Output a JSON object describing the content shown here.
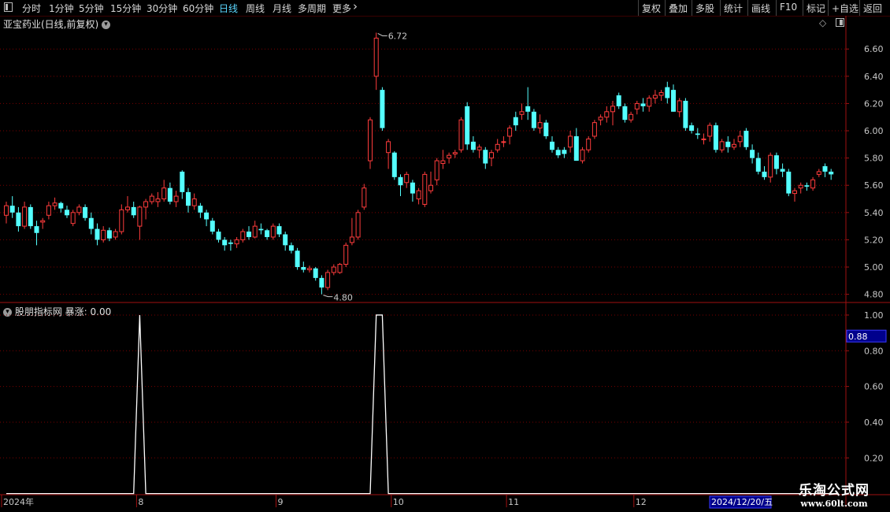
{
  "toolbar": {
    "left": [
      "分时",
      "1分钟",
      "5分钟",
      "15分钟",
      "30分钟",
      "60分钟",
      "日线",
      "周线",
      "月线",
      "多周期",
      "更多"
    ],
    "active": "日线",
    "right": [
      "复权",
      "叠加",
      "多股",
      "统计",
      "画线",
      "F10",
      "标记",
      "+自选",
      "返回"
    ]
  },
  "main_panel": {
    "title": "亚宝药业(日线,前复权)"
  },
  "indicator_panel": {
    "title": "股朋指标网",
    "series_label": "暴涨: 0.00",
    "cursor_value": "0.88"
  },
  "chart_data": [
    {
      "type": "candlestick",
      "title": "亚宝药业(日线,前复权)",
      "y_ticks": [
        "6.60",
        "6.40",
        "6.20",
        "6.00",
        "5.80",
        "5.60",
        "5.40",
        "5.20",
        "5.00",
        "4.80"
      ],
      "ylim": [
        4.74,
        6.74
      ],
      "high_label": "6.72",
      "low_label": "4.80",
      "colors": {
        "up": "#ff3c3c",
        "down": "#54ffff",
        "grid": "#7a0000",
        "axis": "#a01010"
      },
      "ohlc": [
        [
          5.38,
          5.48,
          5.32,
          5.45
        ],
        [
          5.45,
          5.52,
          5.36,
          5.4
        ],
        [
          5.4,
          5.44,
          5.26,
          5.3
        ],
        [
          5.3,
          5.48,
          5.28,
          5.44
        ],
        [
          5.44,
          5.46,
          5.28,
          5.3
        ],
        [
          5.3,
          5.34,
          5.16,
          5.25
        ],
        [
          5.33,
          5.36,
          5.28,
          5.34
        ],
        [
          5.38,
          5.48,
          5.35,
          5.45
        ],
        [
          5.45,
          5.51,
          5.42,
          5.47
        ],
        [
          5.47,
          5.48,
          5.4,
          5.43
        ],
        [
          5.42,
          5.45,
          5.36,
          5.38
        ],
        [
          5.32,
          5.42,
          5.3,
          5.4
        ],
        [
          5.4,
          5.46,
          5.38,
          5.44
        ],
        [
          5.44,
          5.46,
          5.34,
          5.36
        ],
        [
          5.36,
          5.4,
          5.24,
          5.28
        ],
        [
          5.28,
          5.32,
          5.16,
          5.2
        ],
        [
          5.2,
          5.3,
          5.18,
          5.27
        ],
        [
          5.27,
          5.29,
          5.19,
          5.21
        ],
        [
          5.22,
          5.28,
          5.2,
          5.26
        ],
        [
          5.26,
          5.46,
          5.24,
          5.42
        ],
        [
          5.42,
          5.52,
          5.4,
          5.44
        ],
        [
          5.44,
          5.48,
          5.36,
          5.38
        ],
        [
          5.3,
          5.45,
          5.2,
          5.44
        ],
        [
          5.44,
          5.5,
          5.35,
          5.48
        ],
        [
          5.48,
          5.54,
          5.46,
          5.52
        ],
        [
          5.48,
          5.55,
          5.44,
          5.5
        ],
        [
          5.5,
          5.64,
          5.48,
          5.58
        ],
        [
          5.58,
          5.62,
          5.46,
          5.48
        ],
        [
          5.48,
          5.56,
          5.44,
          5.52
        ],
        [
          5.7,
          5.71,
          5.5,
          5.55
        ],
        [
          5.55,
          5.58,
          5.4,
          5.45
        ],
        [
          5.45,
          5.54,
          5.42,
          5.5
        ],
        [
          5.45,
          5.47,
          5.36,
          5.4
        ],
        [
          5.4,
          5.42,
          5.3,
          5.35
        ],
        [
          5.34,
          5.36,
          5.24,
          5.26
        ],
        [
          5.26,
          5.28,
          5.18,
          5.2
        ],
        [
          5.2,
          5.22,
          5.12,
          5.16
        ],
        [
          5.18,
          5.2,
          5.12,
          5.17
        ],
        [
          5.17,
          5.22,
          5.14,
          5.2
        ],
        [
          5.2,
          5.28,
          5.18,
          5.26
        ],
        [
          5.26,
          5.3,
          5.2,
          5.22
        ],
        [
          5.22,
          5.34,
          5.21,
          5.3
        ],
        [
          5.28,
          5.32,
          5.24,
          5.27
        ],
        [
          5.27,
          5.28,
          5.2,
          5.22
        ],
        [
          5.22,
          5.32,
          5.2,
          5.3
        ],
        [
          5.3,
          5.32,
          5.22,
          5.24
        ],
        [
          5.24,
          5.26,
          5.12,
          5.16
        ],
        [
          5.16,
          5.18,
          5.1,
          5.12
        ],
        [
          5.12,
          5.14,
          4.98,
          5.0
        ],
        [
          5.0,
          5.04,
          4.96,
          4.98
        ],
        [
          4.98,
          5.01,
          4.96,
          4.99
        ],
        [
          4.99,
          5.0,
          4.9,
          4.92
        ],
        [
          4.92,
          4.94,
          4.8,
          4.85
        ],
        [
          4.85,
          4.98,
          4.83,
          4.96
        ],
        [
          4.96,
          5.02,
          4.94,
          5.0
        ],
        [
          4.96,
          5.03,
          4.95,
          5.02
        ],
        [
          5.02,
          5.18,
          5.0,
          5.16
        ],
        [
          5.18,
          5.36,
          5.16,
          5.22
        ],
        [
          5.22,
          5.42,
          5.2,
          5.4
        ],
        [
          5.44,
          5.61,
          5.42,
          5.58
        ],
        [
          5.78,
          6.1,
          5.72,
          6.08
        ],
        [
          6.4,
          6.72,
          6.3,
          6.68
        ],
        [
          6.3,
          6.32,
          6.0,
          6.02
        ],
        [
          5.84,
          5.94,
          5.72,
          5.92
        ],
        [
          5.84,
          5.85,
          5.64,
          5.66
        ],
        [
          5.66,
          5.68,
          5.52,
          5.6
        ],
        [
          5.62,
          5.7,
          5.58,
          5.68
        ],
        [
          5.62,
          5.64,
          5.48,
          5.54
        ],
        [
          5.5,
          5.58,
          5.46,
          5.56
        ],
        [
          5.46,
          5.7,
          5.44,
          5.68
        ],
        [
          5.56,
          5.7,
          5.54,
          5.6
        ],
        [
          5.64,
          5.8,
          5.6,
          5.78
        ],
        [
          5.76,
          5.86,
          5.72,
          5.78
        ],
        [
          5.8,
          5.84,
          5.76,
          5.82
        ],
        [
          5.83,
          5.86,
          5.8,
          5.84
        ],
        [
          5.86,
          6.1,
          5.84,
          6.08
        ],
        [
          6.18,
          6.21,
          5.86,
          5.9
        ],
        [
          5.92,
          5.96,
          5.84,
          5.86
        ],
        [
          5.86,
          5.9,
          5.8,
          5.88
        ],
        [
          5.86,
          5.88,
          5.72,
          5.76
        ],
        [
          5.8,
          5.86,
          5.74,
          5.84
        ],
        [
          5.86,
          5.94,
          5.84,
          5.9
        ],
        [
          5.92,
          5.96,
          5.88,
          5.92
        ],
        [
          5.96,
          6.04,
          5.9,
          6.02
        ],
        [
          6.1,
          6.14,
          6.0,
          6.04
        ],
        [
          6.12,
          6.2,
          6.08,
          6.14
        ],
        [
          6.18,
          6.32,
          6.08,
          6.14
        ],
        [
          6.14,
          6.16,
          6.0,
          6.02
        ],
        [
          6.02,
          6.12,
          5.98,
          6.06
        ],
        [
          6.06,
          6.08,
          5.94,
          5.96
        ],
        [
          5.92,
          5.96,
          5.84,
          5.86
        ],
        [
          5.86,
          5.88,
          5.8,
          5.82
        ],
        [
          5.86,
          5.88,
          5.8,
          5.83
        ],
        [
          5.88,
          6.0,
          5.84,
          5.96
        ],
        [
          5.96,
          6.02,
          5.78,
          5.78
        ],
        [
          5.78,
          5.88,
          5.76,
          5.86
        ],
        [
          5.86,
          5.96,
          5.84,
          5.94
        ],
        [
          5.96,
          6.08,
          5.94,
          6.06
        ],
        [
          6.08,
          6.12,
          6.04,
          6.1
        ],
        [
          6.1,
          6.18,
          6.06,
          6.14
        ],
        [
          6.14,
          6.22,
          6.04,
          6.18
        ],
        [
          6.26,
          6.28,
          6.16,
          6.18
        ],
        [
          6.18,
          6.2,
          6.06,
          6.08
        ],
        [
          6.08,
          6.14,
          6.06,
          6.12
        ],
        [
          6.16,
          6.22,
          6.12,
          6.2
        ],
        [
          6.2,
          6.24,
          6.14,
          6.18
        ],
        [
          6.18,
          6.26,
          6.14,
          6.24
        ],
        [
          6.24,
          6.3,
          6.2,
          6.26
        ],
        [
          6.26,
          6.3,
          6.22,
          6.28
        ],
        [
          6.32,
          6.36,
          6.2,
          6.24
        ],
        [
          6.3,
          6.34,
          6.14,
          6.14
        ],
        [
          6.14,
          6.24,
          6.1,
          6.22
        ],
        [
          6.22,
          6.24,
          6.0,
          6.02
        ],
        [
          6.04,
          6.06,
          5.98,
          6.0
        ],
        [
          5.98,
          6.02,
          5.94,
          5.97
        ],
        [
          5.94,
          5.98,
          5.9,
          5.94
        ],
        [
          5.96,
          6.06,
          5.92,
          6.04
        ],
        [
          6.04,
          6.06,
          5.84,
          5.86
        ],
        [
          5.86,
          5.94,
          5.84,
          5.92
        ],
        [
          5.92,
          5.96,
          5.84,
          5.88
        ],
        [
          5.88,
          5.94,
          5.86,
          5.9
        ],
        [
          5.92,
          6.0,
          5.88,
          5.96
        ],
        [
          6.0,
          6.02,
          5.86,
          5.88
        ],
        [
          5.86,
          5.9,
          5.76,
          5.8
        ],
        [
          5.8,
          5.84,
          5.68,
          5.7
        ],
        [
          5.7,
          5.74,
          5.64,
          5.66
        ],
        [
          5.66,
          5.84,
          5.62,
          5.82
        ],
        [
          5.82,
          5.84,
          5.68,
          5.72
        ],
        [
          5.72,
          5.76,
          5.66,
          5.7
        ],
        [
          5.7,
          5.72,
          5.52,
          5.54
        ],
        [
          5.54,
          5.58,
          5.48,
          5.56
        ],
        [
          5.58,
          5.62,
          5.54,
          5.6
        ],
        [
          5.6,
          5.62,
          5.56,
          5.59
        ],
        [
          5.58,
          5.66,
          5.56,
          5.64
        ],
        [
          5.68,
          5.72,
          5.66,
          5.7
        ],
        [
          5.74,
          5.76,
          5.66,
          5.7
        ],
        [
          5.7,
          5.72,
          5.64,
          5.68
        ]
      ]
    },
    {
      "type": "line",
      "name": "暴涨",
      "y_ticks": [
        "1.00",
        "0.80",
        "0.60",
        "0.40",
        "0.20"
      ],
      "ylim": [
        -0.006,
        1.066
      ],
      "values": [
        0,
        0,
        0,
        0,
        0,
        0,
        0,
        0,
        0,
        0,
        0,
        0,
        0,
        0,
        0,
        0,
        0,
        0,
        0,
        0,
        0,
        0,
        0,
        0,
        0,
        0,
        0,
        0,
        0,
        0,
        0,
        0,
        0,
        0,
        0,
        0,
        0,
        0,
        0,
        0,
        0,
        0,
        0,
        0,
        0,
        0,
        0,
        0,
        0,
        0,
        0,
        0,
        0,
        0,
        0,
        0,
        0,
        0,
        0,
        0,
        0,
        0,
        0,
        0,
        0,
        0,
        0,
        0,
        0,
        0,
        0,
        0,
        0,
        0,
        0,
        0,
        0,
        0,
        0,
        0,
        0,
        0,
        0,
        0,
        0,
        0,
        0,
        0,
        0,
        0,
        0,
        0,
        0,
        0,
        0,
        0,
        0,
        0,
        0,
        0,
        0,
        0,
        0,
        0,
        0,
        0,
        0,
        0,
        0,
        0,
        0,
        0,
        0,
        0,
        0,
        0,
        0,
        0,
        0,
        0,
        0,
        0,
        0,
        0,
        0,
        0,
        0,
        0,
        0,
        0,
        0,
        0,
        0,
        0,
        0,
        0,
        0,
        0,
        0,
        0,
        0,
        0,
        0,
        0,
        0,
        0,
        0,
        0,
        0,
        0
      ],
      "spikes": [
        {
          "index": 22,
          "value": 1.0
        },
        {
          "index": 61,
          "value": 1.0
        },
        {
          "index": 62,
          "value": 1.0
        }
      ],
      "color": "#ffffff"
    }
  ],
  "x_axis": {
    "labels": [
      {
        "text": "2024年",
        "index": 0
      },
      {
        "text": "8",
        "index": 22
      },
      {
        "text": "9",
        "index": 45
      },
      {
        "text": "10",
        "index": 64
      },
      {
        "text": "11",
        "index": 83
      },
      {
        "text": "12",
        "index": 104
      }
    ],
    "cursor_label": "2024/12/20/五"
  },
  "watermark": {
    "line1": "乐淘公式网",
    "line2": "www.60lt.com"
  }
}
